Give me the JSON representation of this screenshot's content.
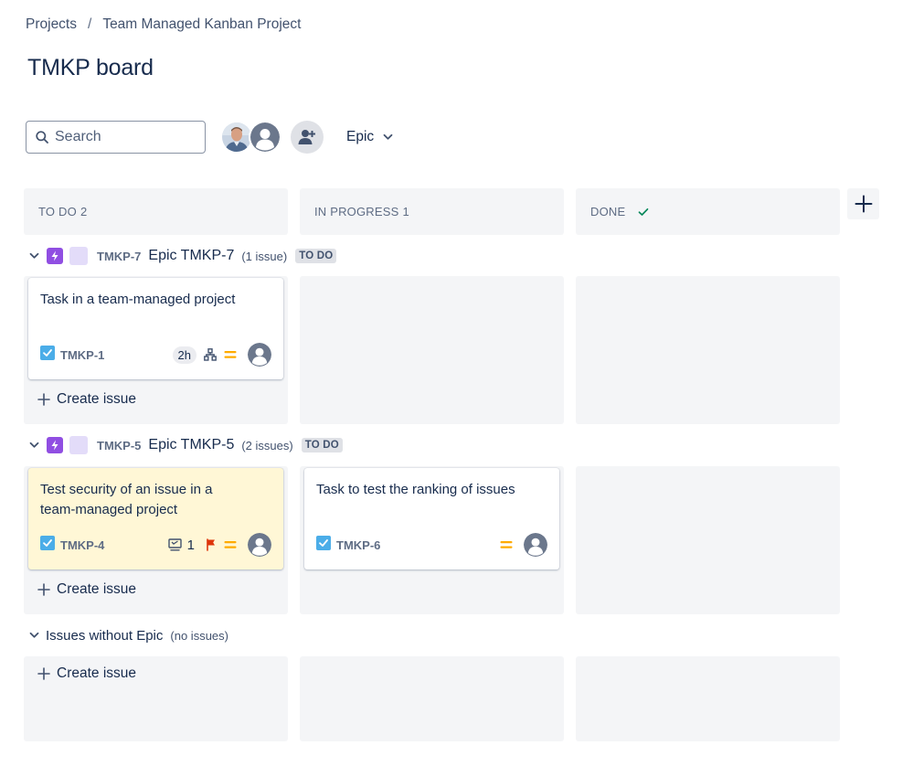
{
  "breadcrumb": {
    "root": "Projects",
    "separator": "/",
    "project": "Team Managed Kanban Project"
  },
  "page": {
    "title": "TMKP board"
  },
  "search": {
    "placeholder": "Search"
  },
  "toolbar": {
    "group_by_label": "Epic"
  },
  "columns": [
    {
      "label": "TO DO",
      "count": "2"
    },
    {
      "label": "IN PROGRESS",
      "count": "1"
    },
    {
      "label": "DONE",
      "count": ""
    }
  ],
  "swimlanes": [
    {
      "key": "TMKP-7",
      "name": "Epic TMKP-7",
      "count": "(1 issue)",
      "status": "TO DO"
    },
    {
      "key": "TMKP-5",
      "name": "Epic TMKP-5",
      "count": "(2 issues)",
      "status": "TO DO"
    },
    {
      "name": "Issues without Epic",
      "count": "(no issues)"
    }
  ],
  "cards": [
    {
      "summary": "Task in a team-managed project",
      "key": "TMKP-1",
      "estimate": "2h",
      "icon_type": "checkbox-icon"
    },
    {
      "summary": "Test security of an issue in a team-managed project",
      "key": "TMKP-4",
      "child_count": "1",
      "flagged": true,
      "icon_type": "checkbox-icon"
    },
    {
      "summary": "Task to test the ranking of issues",
      "key": "TMKP-6",
      "icon_type": "checkbox-icon"
    }
  ],
  "actions": {
    "create_issue": "Create issue"
  },
  "colors": {
    "epic_purple": "#904ee2",
    "epic_color_swatch": "#e3dcf9",
    "task_blue": "#4bade8",
    "priority_medium": "#ffab00",
    "flag_red": "#de350b",
    "done_check": "#00875a",
    "flagged_card_bg": "#fff7d6"
  }
}
